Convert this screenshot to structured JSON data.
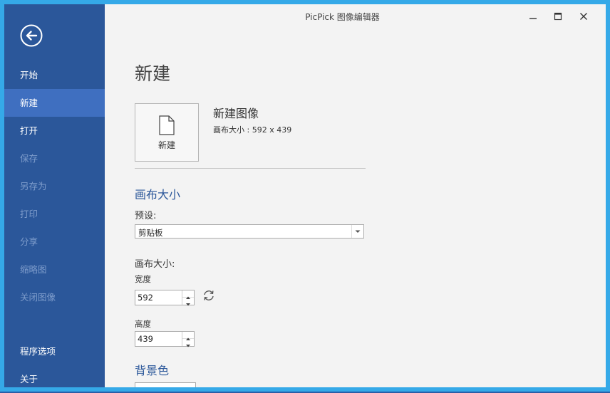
{
  "window": {
    "title": "PicPick 图像编辑器"
  },
  "sidebar": {
    "items": [
      {
        "label": "开始",
        "state": "normal"
      },
      {
        "label": "新建",
        "state": "active"
      },
      {
        "label": "打开",
        "state": "normal"
      },
      {
        "label": "保存",
        "state": "disabled"
      },
      {
        "label": "另存为",
        "state": "disabled"
      },
      {
        "label": "打印",
        "state": "disabled"
      },
      {
        "label": "分享",
        "state": "disabled"
      },
      {
        "label": "缩略图",
        "state": "disabled"
      },
      {
        "label": "关闭图像",
        "state": "disabled"
      }
    ],
    "bottom_items": [
      {
        "label": "程序选项"
      },
      {
        "label": "关于"
      }
    ]
  },
  "main": {
    "page_title": "新建",
    "new_tile_label": "新建",
    "new_image_title": "新建图像",
    "new_image_desc": "画布大小 : 592 x 439",
    "canvas_section_title": "画布大小",
    "preset_label": "预设:",
    "preset_value": "剪贴板",
    "canvas_size_label": "画布大小:",
    "width_label": "宽度",
    "width_value": "592",
    "height_label": "高度",
    "height_value": "439",
    "background_section_title": "背景色"
  },
  "colors": {
    "sidebar_bg": "#2b579a",
    "sidebar_active": "#3f6fc0",
    "accent_text": "#2b579a",
    "window_frame": "#35a9e8"
  }
}
